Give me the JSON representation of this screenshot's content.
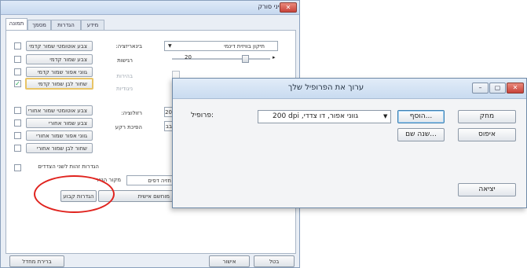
{
  "main_window": {
    "title": "מאפייני סורק",
    "close_label": "✕",
    "tabs": [
      {
        "label": "תמונה",
        "active": true
      },
      {
        "label": "מסמך"
      },
      {
        "label": "הגדרות"
      },
      {
        "label": "מידע"
      }
    ],
    "image_types_front": [
      {
        "label": "צבע אוטומטי שמור קדמי",
        "checked": false
      },
      {
        "label": "צבע שמור קדמי",
        "checked": false
      },
      {
        "label": "גווני אפור שמור קדמי",
        "checked": false
      },
      {
        "label": "שחור לבן שמור קדמי",
        "checked": true
      }
    ],
    "image_types_back": [
      {
        "label": "צבע אוטומטי שמור אחורי",
        "checked": false
      },
      {
        "label": "צבע שמור אחורי",
        "checked": false
      },
      {
        "label": "גווני אפור שמור אחורי",
        "checked": false
      },
      {
        "label": "שחור לבן שמור אחורי",
        "checked": false
      }
    ],
    "binarization_label": "בינאריזציה:",
    "binarization_value": "תיקון בוויזית דינמי",
    "threshold_label": "רגישות",
    "threshold_value": "20",
    "brightness_label": "בהירות",
    "contrast_label": "ניגודיות",
    "resolution_label": "רזולוציה:",
    "resolution_value": "20",
    "inversion_label": "הפיכת רקע",
    "inversion_value": "בב",
    "same_settings_label": "הגדרות זהות לשני הצדדים",
    "scan_source_label": "מקור הנייר",
    "scan_source_value": "חזיה דפים",
    "preset_button": "הגדרות קבוע",
    "mode_button": "מוחשם אישית",
    "default_button": "ברירת מחדל",
    "ok_button": "אישור",
    "cancel_button": "בטל"
  },
  "dialog": {
    "title": "ערוך את הפרופיל שלך",
    "profile_label": "פרופיל:",
    "profile_value": "200 dpi ,גווני אפור, דו צדדי",
    "add_button": "הוסף...",
    "delete_button": "מחק",
    "rename_button": "שנה שם...",
    "reset_button": "איפוס",
    "exit_button": "יציאה"
  }
}
